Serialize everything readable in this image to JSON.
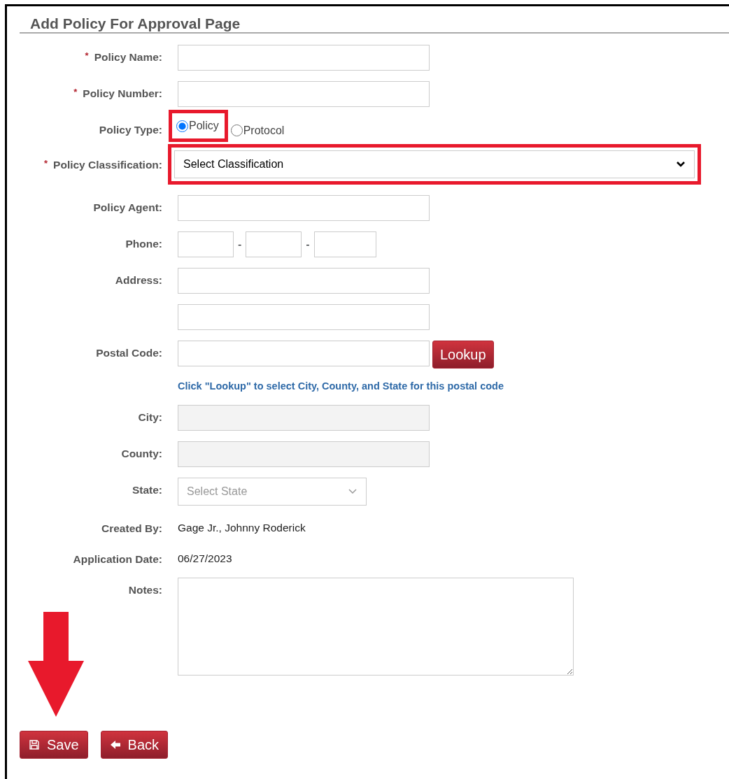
{
  "title": "Add Policy For Approval Page",
  "fields": [
    {
      "kind": "text",
      "label": "Policy Name:",
      "required_mark": "*"
    },
    {
      "kind": "text",
      "label": "Policy Number:",
      "required_mark": "*"
    },
    {
      "kind": "radio",
      "label": "Policy Type:",
      "options": [
        {
          "label": "Policy",
          "selected": true,
          "highlighted": true
        },
        {
          "label": "Protocol",
          "selected": false
        }
      ]
    },
    {
      "kind": "select",
      "label": "Policy Classification:",
      "required_mark": "*",
      "value": "Select Classification",
      "highlighted": true
    },
    {
      "kind": "text",
      "label": "Policy Agent:"
    },
    {
      "kind": "phone",
      "label": "Phone:",
      "separators": [
        "-",
        "-"
      ]
    },
    {
      "kind": "text",
      "label": "Address:"
    },
    {
      "kind": "text"
    },
    {
      "kind": "lookup",
      "label": "Postal Code:",
      "button": "Lookup"
    },
    {
      "kind": "hint",
      "text": "Click \"Lookup\" to select City, County, and State for this postal code"
    },
    {
      "kind": "text",
      "label": "City:",
      "disabled": true
    },
    {
      "kind": "text",
      "label": "County:",
      "disabled": true
    },
    {
      "kind": "select",
      "label": "State:",
      "value": "Select State",
      "disabled": true
    },
    {
      "kind": "static",
      "label": "Created By:",
      "value": "Gage Jr., Johnny Roderick"
    },
    {
      "kind": "static",
      "label": "Application Date:",
      "value": "06/27/2023"
    },
    {
      "kind": "textarea",
      "label": "Notes:"
    }
  ],
  "buttons": [
    {
      "kind": "save",
      "label": "Save",
      "callout_arrow": true
    },
    {
      "kind": "back",
      "label": "Back"
    }
  ]
}
